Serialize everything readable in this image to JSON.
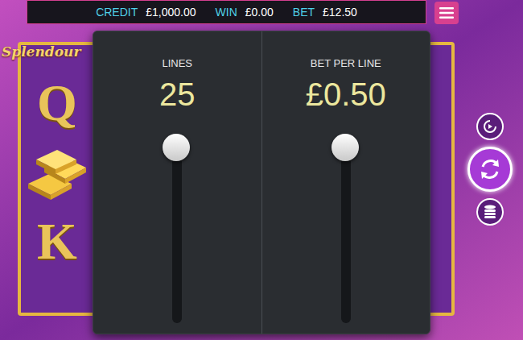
{
  "top_bar": {
    "credit_label": "CREDIT",
    "credit": "£1,000.00",
    "win_label": "WIN",
    "win": "£0.00",
    "bet_label": "BET",
    "bet": "£12.50"
  },
  "logo": "Splendour",
  "reel_symbols": [
    {
      "kind": "letter",
      "text": "Q"
    },
    {
      "kind": "bars"
    },
    {
      "kind": "letter",
      "text": "K"
    }
  ],
  "settings": [
    {
      "label": "LINES",
      "value": "25",
      "level": 1
    },
    {
      "label": "BET PER LINE",
      "value": "£0.50",
      "level": 1
    }
  ]
}
